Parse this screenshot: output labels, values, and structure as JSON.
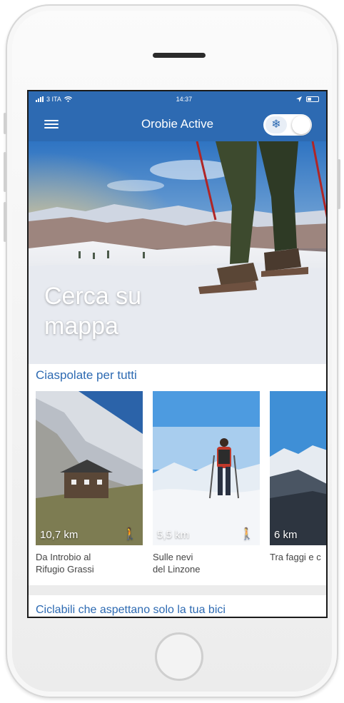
{
  "status_bar": {
    "carrier": "3 ITA",
    "time": "14:37"
  },
  "navbar": {
    "title": "Orobie Active",
    "menu_icon": "hamburger-icon",
    "toggle_icon": "snowflake-icon",
    "toggle_on": true
  },
  "hero": {
    "title": "Cerca su mappa"
  },
  "sections": [
    {
      "title": "Ciaspolate per tutti",
      "cards": [
        {
          "distance": "10,7 km",
          "label": "Da Introbio al\nRifugio Grassi",
          "icon": "hiker-icon"
        },
        {
          "distance": "5,5 km",
          "label": "Sulle nevi\ndel Linzone",
          "icon": "hiker-icon"
        },
        {
          "distance": "6 km",
          "label": "Tra faggi e c",
          "icon": "hiker-icon"
        }
      ]
    },
    {
      "title": "Ciclabili che aspettano solo la tua bici"
    }
  ],
  "colors": {
    "accent": "#2d6ab2",
    "text": "#444444"
  }
}
